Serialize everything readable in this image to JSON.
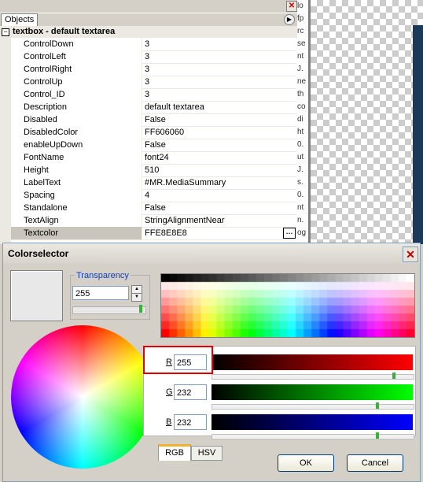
{
  "objects_panel": {
    "tab_label": "Objects",
    "group_toggle": "−",
    "group_title": "textbox - default textarea",
    "properties": [
      {
        "name": "ControlDown",
        "value": "3"
      },
      {
        "name": "ControlLeft",
        "value": "3"
      },
      {
        "name": "ControlRight",
        "value": "3"
      },
      {
        "name": "ControlUp",
        "value": "3"
      },
      {
        "name": "Control_ID",
        "value": "3"
      },
      {
        "name": "Description",
        "value": "default textarea"
      },
      {
        "name": "Disabled",
        "value": "False"
      },
      {
        "name": "DisabledColor",
        "value": "FF606060"
      },
      {
        "name": "enableUpDown",
        "value": "False"
      },
      {
        "name": "FontName",
        "value": "font24"
      },
      {
        "name": "Height",
        "value": "510"
      },
      {
        "name": "LabelText",
        "value": "#MR.MediaSummary"
      },
      {
        "name": "Spacing",
        "value": "4"
      },
      {
        "name": "Standalone",
        "value": "False"
      },
      {
        "name": "TextAlign",
        "value": "StringAlignmentNear"
      },
      {
        "name": "Textcolor",
        "value": "FFE8E8E8"
      }
    ],
    "ellipsis": "…"
  },
  "strip_text": [
    "lo",
    "fp",
    "rc",
    "se",
    "nt",
    "J.",
    "ne",
    "th",
    "co",
    "di",
    "ht",
    "0.",
    "ut",
    "J.",
    "s.",
    "0.",
    "nt",
    "n.",
    "og"
  ],
  "colorselector": {
    "title": "Colorselector",
    "transparency": {
      "label": "Transparency",
      "value": "255",
      "level": 1.0
    },
    "channels": [
      {
        "label": "R",
        "value": "255",
        "level": 1.0,
        "from": "#000000",
        "to": "#ff0000"
      },
      {
        "label": "G",
        "value": "232",
        "level": 0.91,
        "from": "#000000",
        "to": "#00ff00"
      },
      {
        "label": "B",
        "value": "232",
        "level": 0.91,
        "from": "#000000",
        "to": "#0000ff"
      }
    ],
    "tabs": [
      "RGB",
      "HSV"
    ],
    "ok_label": "OK",
    "cancel_label": "Cancel",
    "preview_color": "#e8e8e8"
  }
}
